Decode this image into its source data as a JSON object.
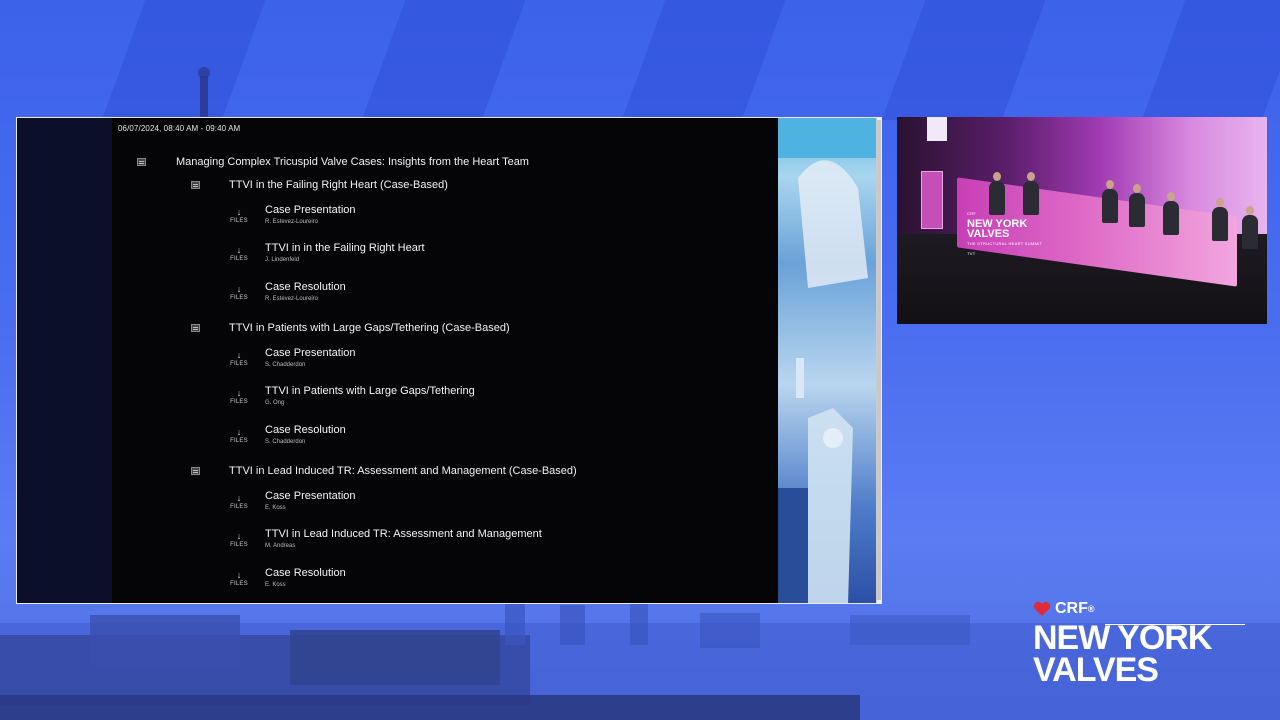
{
  "slide": {
    "datetime": "06/07/2024, 08:40 AM - 09:40 AM",
    "session_title": "Managing Complex Tricuspid Valve Cases: Insights from the Heart Team",
    "files_label": "FILES",
    "groups": [
      {
        "title": "TTVI in the Failing Right Heart (Case-Based)",
        "talks": [
          {
            "title": "Case Presentation",
            "speaker": "R. Estevez-Loureiro"
          },
          {
            "title": "TTVI in in the Failing Right Heart",
            "speaker": "J. Lindenfeld"
          },
          {
            "title": "Case Resolution",
            "speaker": "R. Estevez-Loureiro"
          }
        ]
      },
      {
        "title": "TTVI in Patients with Large Gaps/Tethering (Case-Based)",
        "talks": [
          {
            "title": "Case Presentation",
            "speaker": "S. Chadderdon"
          },
          {
            "title": "TTVI in Patients with Large Gaps/Tethering",
            "speaker": "G. Ong"
          },
          {
            "title": "Case Resolution",
            "speaker": "S. Chadderdon"
          }
        ]
      },
      {
        "title": "TTVI in Lead Induced TR: Assessment and Management (Case-Based)",
        "talks": [
          {
            "title": "Case Presentation",
            "speaker": "E. Koss"
          },
          {
            "title": "TTVI in Lead Induced TR: Assessment and Management",
            "speaker": "M. Andreas"
          },
          {
            "title": "Case Resolution",
            "speaker": "E. Koss"
          }
        ]
      }
    ]
  },
  "video": {
    "table_brand": "CRF",
    "table_line1": "NEW YORK",
    "table_line2": "VALVES",
    "table_tagline": "THE STRUCTURAL HEART SUMMIT",
    "table_tvt": "TVT"
  },
  "logo": {
    "brand": "CRF",
    "registered": "®",
    "line1": "NEW YORK",
    "line2": "VALVES"
  },
  "colors": {
    "background": "#4a6df0",
    "slide_bg": "#050508",
    "accent_red": "#e02a3a"
  },
  "icons": {
    "download": "arrow-down-icon",
    "session_toggle": "collapse-icon"
  }
}
